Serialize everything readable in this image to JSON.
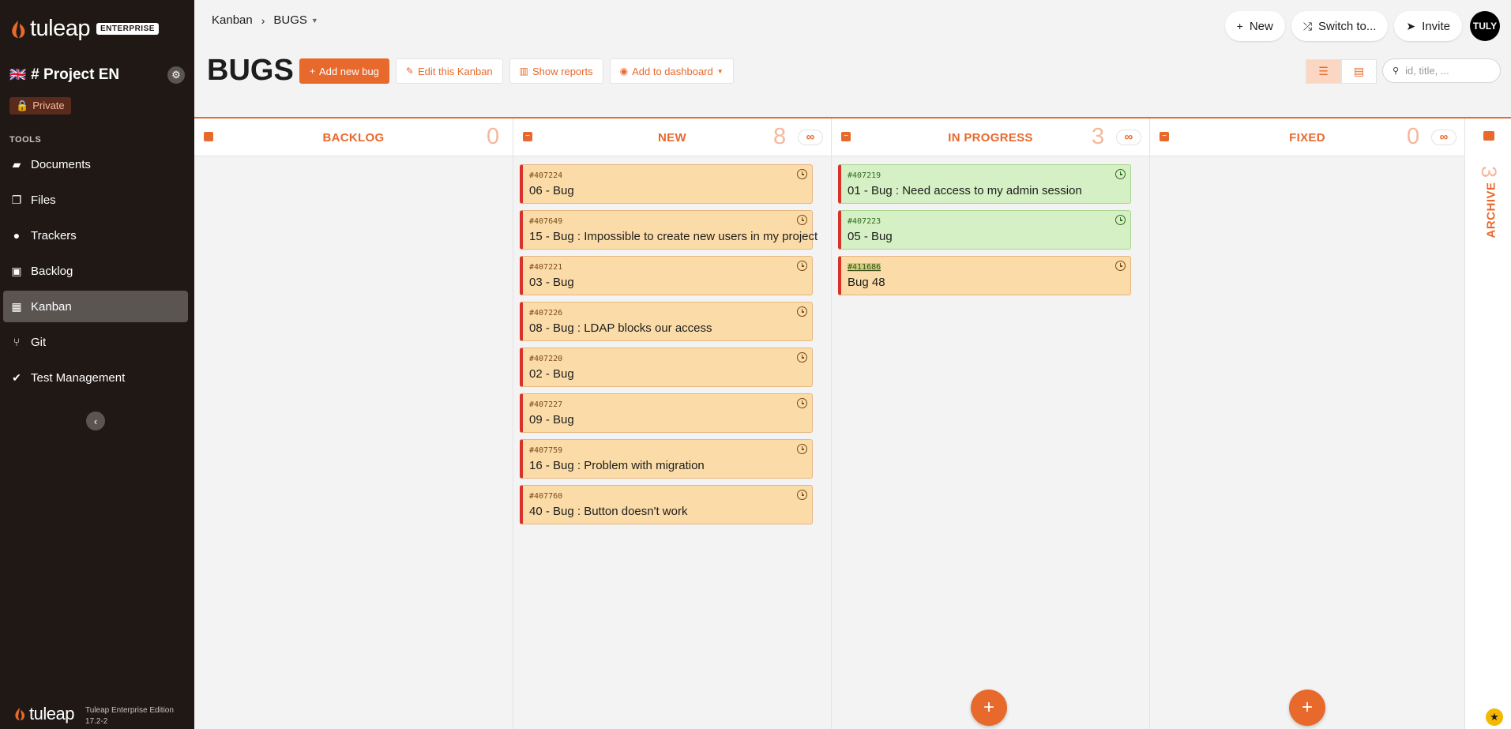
{
  "app": {
    "logo_text": "tuleap",
    "logo_badge": "ENTERPRISE",
    "edition": "Tuleap Enterprise Edition",
    "version": "17.2-2"
  },
  "project": {
    "flag": "🇬🇧",
    "name": "# Project EN",
    "privacy": "Private"
  },
  "sidebar": {
    "tools_label": "TOOLS",
    "items": [
      {
        "label": "Documents",
        "icon": "folder-icon"
      },
      {
        "label": "Files",
        "icon": "files-icon"
      },
      {
        "label": "Trackers",
        "icon": "tracker-icon"
      },
      {
        "label": "Backlog",
        "icon": "backlog-icon"
      },
      {
        "label": "Kanban",
        "icon": "kanban-icon",
        "active": true
      },
      {
        "label": "Git",
        "icon": "git-icon"
      },
      {
        "label": "Test Management",
        "icon": "check-icon"
      }
    ]
  },
  "breadcrumb": {
    "parent": "Kanban",
    "current": "BUGS"
  },
  "top_actions": {
    "new": "New",
    "switch": "Switch to...",
    "invite": "Invite",
    "avatar": "TULY"
  },
  "page": {
    "title": "BUGS"
  },
  "actions": {
    "add": "Add new bug",
    "edit": "Edit this Kanban",
    "reports": "Show reports",
    "dashboard": "Add to dashboard"
  },
  "search": {
    "placeholder": "id, title, ..."
  },
  "columns": {
    "backlog": {
      "title": "BACKLOG",
      "count": "0"
    },
    "new": {
      "title": "NEW",
      "count": "8",
      "wip": "∞"
    },
    "in_progress": {
      "title": "IN PROGRESS",
      "count": "3",
      "wip": "∞"
    },
    "fixed": {
      "title": "FIXED",
      "count": "0",
      "wip": "∞"
    },
    "archive": {
      "title": "ARCHIVE",
      "count": "3"
    }
  },
  "cards_new": [
    {
      "id": "#407224",
      "title": "06 - Bug"
    },
    {
      "id": "#407649",
      "title": "15 - Bug : Impossible to create new users in my project"
    },
    {
      "id": "#407221",
      "title": "03 - Bug"
    },
    {
      "id": "#407226",
      "title": "08 - Bug : LDAP blocks our access"
    },
    {
      "id": "#407220",
      "title": "02 - Bug"
    },
    {
      "id": "#407227",
      "title": "09 - Bug"
    },
    {
      "id": "#407759",
      "title": "16 - Bug : Problem with migration"
    },
    {
      "id": "#407760",
      "title": "40 - Bug : Button doesn't work"
    }
  ],
  "cards_in_progress": [
    {
      "id": "#407219",
      "title": "01 - Bug : Need access to my admin session",
      "color": "green"
    },
    {
      "id": "#407223",
      "title": "05 - Bug",
      "color": "green"
    },
    {
      "id": "#411686",
      "title": "Bug 48",
      "color": "orange"
    }
  ],
  "colors": {
    "accent": "#e8692c",
    "sidebar": "#1f1815",
    "card_orange": "#fbdca8",
    "card_green": "#d5f0c4",
    "card_stripe": "#d9322a"
  }
}
